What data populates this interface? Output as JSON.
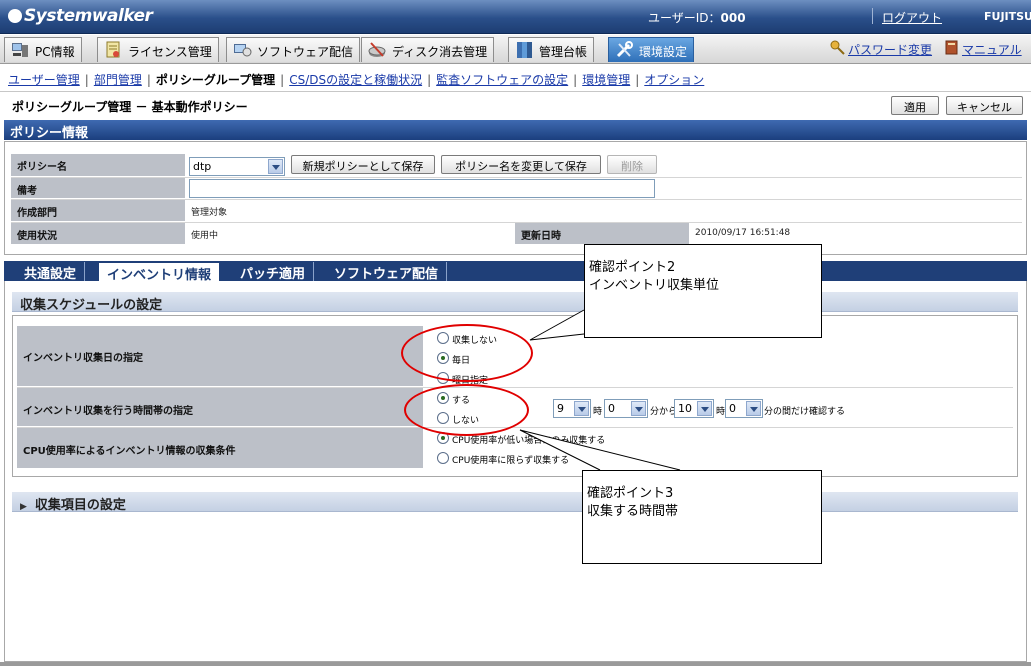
{
  "header": {
    "logo": "Systemwalker",
    "user_id_label": "ユーザーID：",
    "user_id_value": "000",
    "logout": "ログアウト",
    "vendor": "FUJITSU"
  },
  "main_tabs": [
    {
      "label": "PC情報",
      "icon": "pc-icon"
    },
    {
      "label": "ライセンス管理",
      "icon": "license-icon"
    },
    {
      "label": "ソフトウェア配信",
      "icon": "software-delivery-icon"
    },
    {
      "label": "ディスク消去管理",
      "icon": "disk-erase-icon"
    },
    {
      "label": "管理台帳",
      "icon": "ledger-icon"
    },
    {
      "label": "環境設定",
      "icon": "tools-icon"
    }
  ],
  "top_links": {
    "password": "パスワード変更",
    "manual": "マニュアル"
  },
  "sub_nav": {
    "items": [
      "ユーザー管理",
      "部門管理",
      "ポリシーグループ管理",
      "CS/DSの設定と稼働状況",
      "監査ソフトウェアの設定",
      "環境管理",
      "オプション"
    ],
    "current": "ポリシーグループ管理"
  },
  "page": {
    "title": "ポリシーグループ管理 － 基本動作ポリシー",
    "apply": "適用",
    "cancel": "キャンセル"
  },
  "policy_info": {
    "section_title": "ポリシー情報",
    "name_label": "ポリシー名",
    "name_value": "dtp",
    "save_new": "新規ポリシーとして保存",
    "save_rename": "ポリシー名を変更して保存",
    "delete": "削除",
    "remark_label": "備考",
    "remark_value": "",
    "dept_label": "作成部門",
    "dept_value": "管理対象",
    "usage_label": "使用状況",
    "usage_value": "使用中",
    "updated_label": "更新日時",
    "updated_value": "2010/09/17 16:51:48"
  },
  "sub_tabs": [
    "共通設定",
    "インベントリ情報",
    "パッチ適用",
    "ソフトウェア配信"
  ],
  "active_sub_tab": "インベントリ情報",
  "schedule": {
    "title": "収集スケジュールの設定",
    "day_label": "インベントリ収集日の指定",
    "day_options": [
      "収集しない",
      "毎日",
      "曜日指定"
    ],
    "day_selected": "毎日",
    "time_label": "インベントリ収集を行う時間帯の指定",
    "time_options": [
      "する",
      "しない"
    ],
    "time_selected": "する",
    "start_hour": "9",
    "hour_unit": "時",
    "start_min": "0",
    "from_unit": "分から",
    "end_hour": "10",
    "end_min": "0",
    "end_text": "分の間だけ確認する",
    "cpu_label": "CPU使用率によるインベントリ情報の収集条件",
    "cpu_options": [
      "CPU使用率が低い場合にのみ収集する",
      "CPU使用率に限らず収集する"
    ],
    "cpu_selected": "CPU使用率が低い場合にのみ収集する"
  },
  "items_section": {
    "title": "収集項目の設定"
  },
  "callouts": {
    "point2_line1": "確認ポイント2",
    "point2_line2": "インベントリ収集単位",
    "point3_line1": "確認ポイント3",
    "point3_line2": "収集する時間帯"
  }
}
